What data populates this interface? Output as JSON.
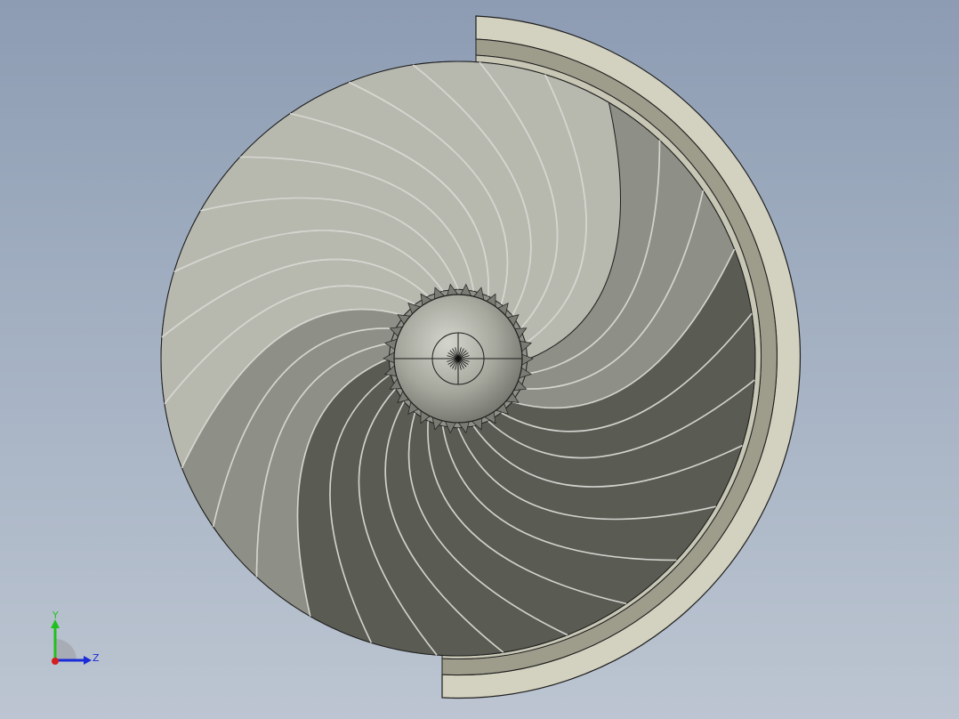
{
  "viewport": {
    "background_top": "#8d9cb3",
    "background_bottom": "#bcc5d1"
  },
  "model": {
    "name": "fan-rotor-with-half-casing",
    "blade_count": 28,
    "blade_light": "#b7b8ae",
    "blade_mid": "#8e8f86",
    "blade_dark": "#5a5b53",
    "edge_color": "#1e1e1e",
    "casing_fill": "#c9c8b6",
    "casing_inner": "#9d9c8b"
  },
  "triad": {
    "y_label": "Y",
    "z_label": "Z",
    "y_color": "#22c01e",
    "z_color": "#1a2cd8",
    "x_color": "#d61c1c"
  }
}
